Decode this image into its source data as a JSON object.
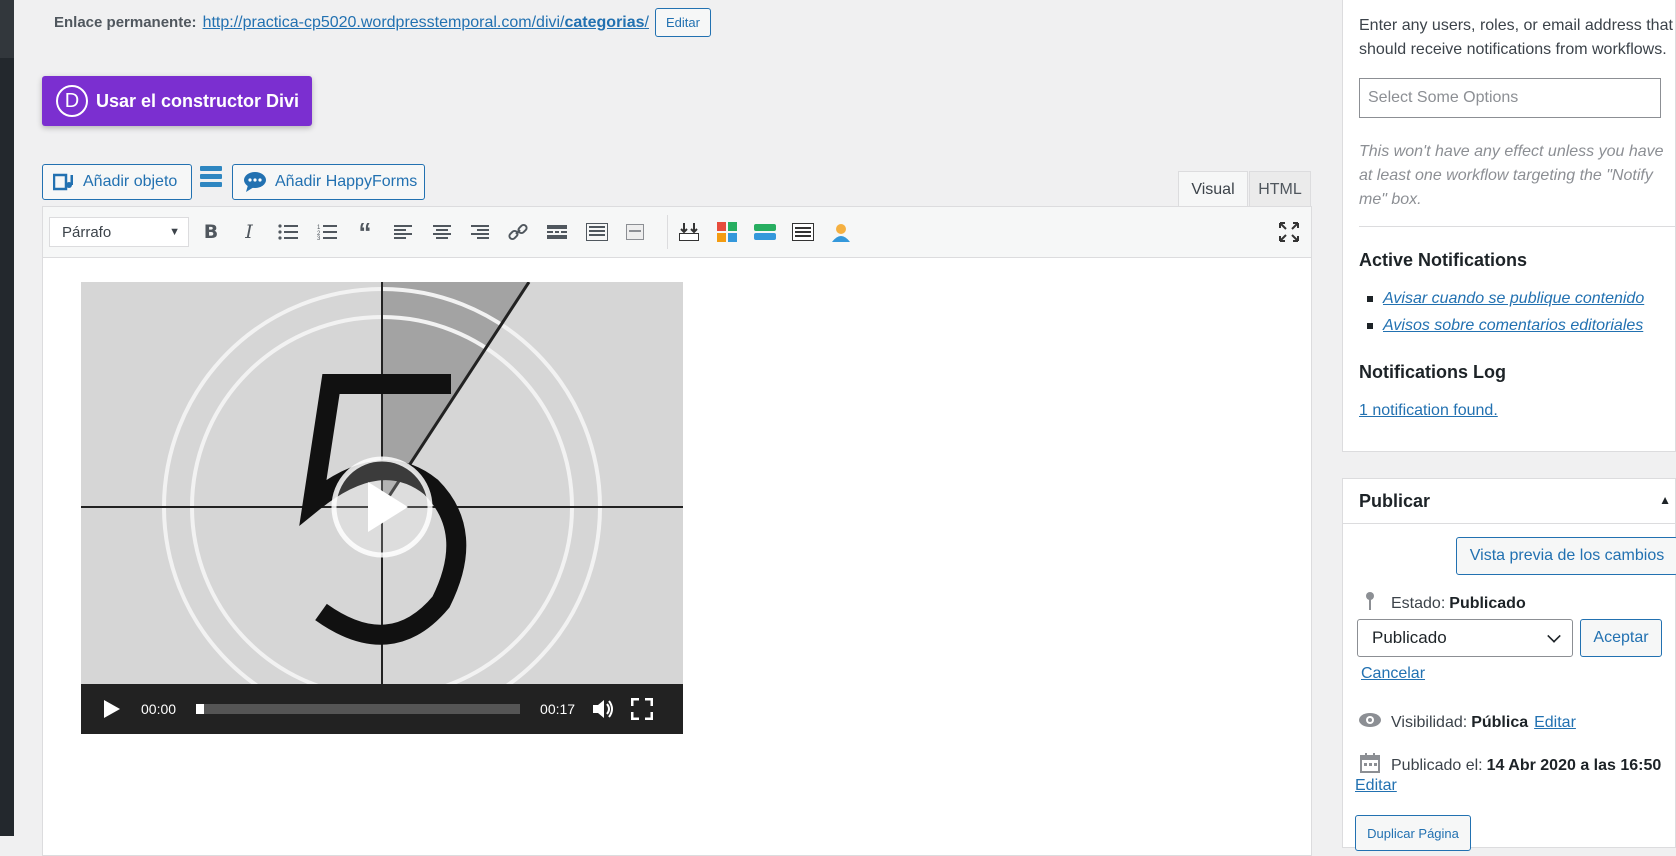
{
  "permalink": {
    "label": "Enlace permanente:",
    "url_base": "http://practica-cp5020.wordpresstemporal.com/divi/",
    "url_slug": "categorias",
    "url_end": "/",
    "edit_button": "Editar"
  },
  "divi": {
    "logo_letter": "D",
    "label": "Usar el constructor Divi"
  },
  "media_buttons": {
    "add_object": "Añadir objeto",
    "add_happyforms": "Añadir HappyForms"
  },
  "editor_tabs": {
    "visual": "Visual",
    "html": "HTML"
  },
  "toolbar": {
    "format": "Párrafo",
    "icons": [
      "bold-icon",
      "italic-icon",
      "bullet-list-icon",
      "numbered-list-icon",
      "blockquote-icon",
      "align-left-icon",
      "align-center-icon",
      "align-right-icon",
      "link-icon",
      "read-more-icon",
      "toolbar-toggle-icon",
      "page-break-icon",
      "insert-icon",
      "shortcodes-icon",
      "layout-icon",
      "table-icon",
      "user-icon",
      "fullscreen-icon"
    ]
  },
  "video": {
    "current_time": "00:00",
    "duration": "00:17",
    "progress": 0
  },
  "notifications": {
    "intro": "Enter any users, roles, or email address that should receive notifications from workflows.",
    "select_placeholder": "Select Some Options",
    "hint": "This won't have any effect unless you have at least one workflow targeting the \"Notify me\" box.",
    "active_heading": "Active Notifications",
    "active_items": [
      "Avisar cuando se publique contenido",
      "Avisos sobre comentarios editoriales"
    ],
    "log_heading": "Notifications Log",
    "log_link": "1 notification found."
  },
  "publish": {
    "title": "Publicar",
    "preview_button": "Vista previa de los cambios",
    "status_label": "Estado:",
    "status_value": "Publicado",
    "status_select": "Publicado",
    "accept_button": "Aceptar",
    "cancel_link": "Cancelar",
    "visibility_label": "Visibilidad:",
    "visibility_value": "Pública",
    "visibility_edit": "Editar",
    "published_label": "Publicado el:",
    "published_value": "14 Abr 2020 a las 16:50",
    "published_edit": "Editar",
    "duplicate_button": "Duplicar Página"
  },
  "colors": {
    "divi_purple": "#7b2fd0",
    "link_blue": "#2271b1",
    "admin_dark": "#23282d"
  }
}
